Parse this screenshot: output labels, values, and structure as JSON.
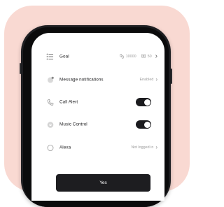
{
  "settings": {
    "goal": {
      "label": "Goal",
      "steps_value": "10000",
      "calories_value": "50"
    },
    "message_notifications": {
      "label": "Message notifications",
      "status": "Enabled"
    },
    "call_alert": {
      "label": "Call Alert",
      "enabled": true
    },
    "music_control": {
      "label": "Music Control",
      "enabled": true
    },
    "alexa": {
      "label": "Alexa",
      "status": "Not logged in"
    }
  },
  "actions": {
    "confirm_label": "Yes"
  },
  "colors": {
    "background_blob": "#f9d9d2",
    "phone_frame": "#1f1f22",
    "toggle_on": "#1b1b1e",
    "button": "#1d1d20"
  },
  "icons": {
    "goal": "list-icon",
    "steps": "steps-icon",
    "calories": "calories-icon",
    "notifications": "chat-bubble-icon",
    "call": "phone-icon",
    "music": "music-disc-icon",
    "alexa": "alexa-ring-icon",
    "chevron": "chevron-right-icon"
  }
}
